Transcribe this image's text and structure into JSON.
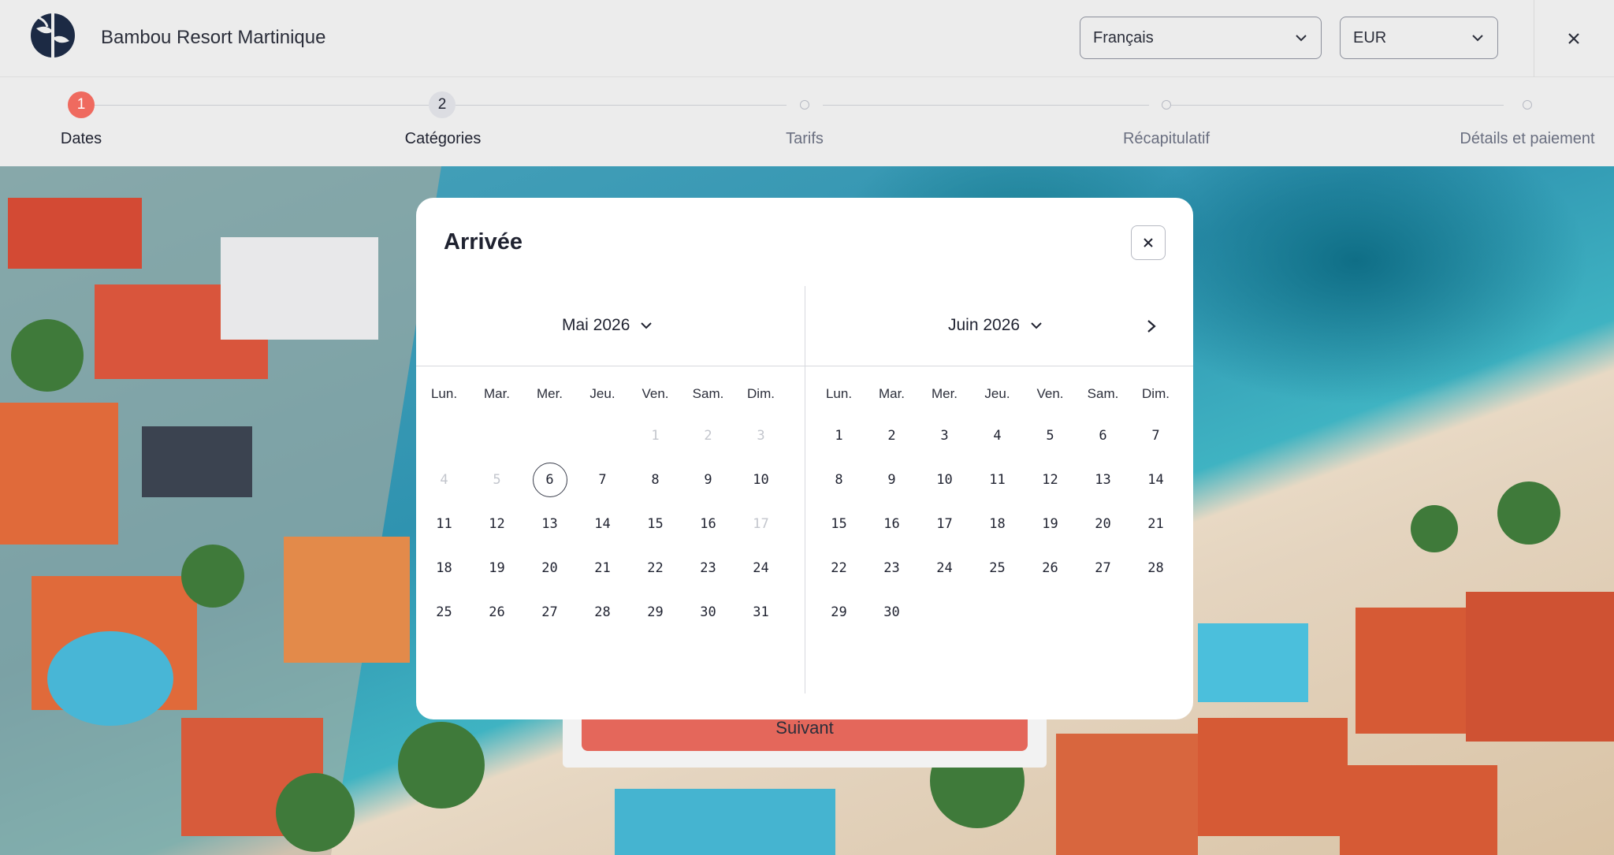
{
  "header": {
    "brand": "Bambou Resort Martinique",
    "language": {
      "selected": "Français"
    },
    "currency": {
      "selected": "EUR"
    }
  },
  "stepper": {
    "steps": [
      {
        "number": "1",
        "label": "Dates",
        "state": "active"
      },
      {
        "number": "2",
        "label": "Catégories",
        "state": "next"
      },
      {
        "number": "",
        "label": "Tarifs",
        "state": "upcoming"
      },
      {
        "number": "",
        "label": "Récapitulatif",
        "state": "upcoming"
      },
      {
        "number": "",
        "label": "Détails et paiement",
        "state": "upcoming"
      }
    ]
  },
  "modal": {
    "title": "Arrivée",
    "weekdays": [
      "Lun.",
      "Mar.",
      "Mer.",
      "Jeu.",
      "Ven.",
      "Sam.",
      "Dim."
    ],
    "months": [
      {
        "label": "Mai 2026",
        "weeks": [
          [
            null,
            null,
            null,
            null,
            {
              "d": "1",
              "dis": true
            },
            {
              "d": "2",
              "dis": true
            },
            {
              "d": "3",
              "dis": true
            }
          ],
          [
            {
              "d": "4",
              "dis": true
            },
            {
              "d": "5",
              "dis": true
            },
            {
              "d": "6",
              "sel": true
            },
            {
              "d": "7"
            },
            {
              "d": "8"
            },
            {
              "d": "9"
            },
            {
              "d": "10"
            }
          ],
          [
            {
              "d": "11"
            },
            {
              "d": "12"
            },
            {
              "d": "13"
            },
            {
              "d": "14"
            },
            {
              "d": "15"
            },
            {
              "d": "16"
            },
            {
              "d": "17",
              "dis": true
            }
          ],
          [
            {
              "d": "18"
            },
            {
              "d": "19"
            },
            {
              "d": "20"
            },
            {
              "d": "21"
            },
            {
              "d": "22"
            },
            {
              "d": "23"
            },
            {
              "d": "24"
            }
          ],
          [
            {
              "d": "25"
            },
            {
              "d": "26"
            },
            {
              "d": "27"
            },
            {
              "d": "28"
            },
            {
              "d": "29"
            },
            {
              "d": "30"
            },
            {
              "d": "31"
            }
          ]
        ]
      },
      {
        "label": "Juin 2026",
        "weeks": [
          [
            {
              "d": "1"
            },
            {
              "d": "2"
            },
            {
              "d": "3"
            },
            {
              "d": "4"
            },
            {
              "d": "5"
            },
            {
              "d": "6"
            },
            {
              "d": "7"
            }
          ],
          [
            {
              "d": "8"
            },
            {
              "d": "9"
            },
            {
              "d": "10"
            },
            {
              "d": "11"
            },
            {
              "d": "12"
            },
            {
              "d": "13"
            },
            {
              "d": "14"
            }
          ],
          [
            {
              "d": "15"
            },
            {
              "d": "16"
            },
            {
              "d": "17"
            },
            {
              "d": "18"
            },
            {
              "d": "19"
            },
            {
              "d": "20"
            },
            {
              "d": "21"
            }
          ],
          [
            {
              "d": "22"
            },
            {
              "d": "23"
            },
            {
              "d": "24"
            },
            {
              "d": "25"
            },
            {
              "d": "26"
            },
            {
              "d": "27"
            },
            {
              "d": "28"
            }
          ],
          [
            {
              "d": "29"
            },
            {
              "d": "30"
            },
            null,
            null,
            null,
            null,
            null
          ]
        ]
      }
    ]
  },
  "footer": {
    "next_label": "Suivant"
  },
  "colors": {
    "accent": "#ef6a5f",
    "button": "#e4675b",
    "text": "#1f2230",
    "muted": "#6a6f80"
  },
  "icons": {
    "logo": "resort-logo-icon",
    "close": "close-icon",
    "dropdown": "chevron-down-icon",
    "next": "chevron-right-icon"
  }
}
